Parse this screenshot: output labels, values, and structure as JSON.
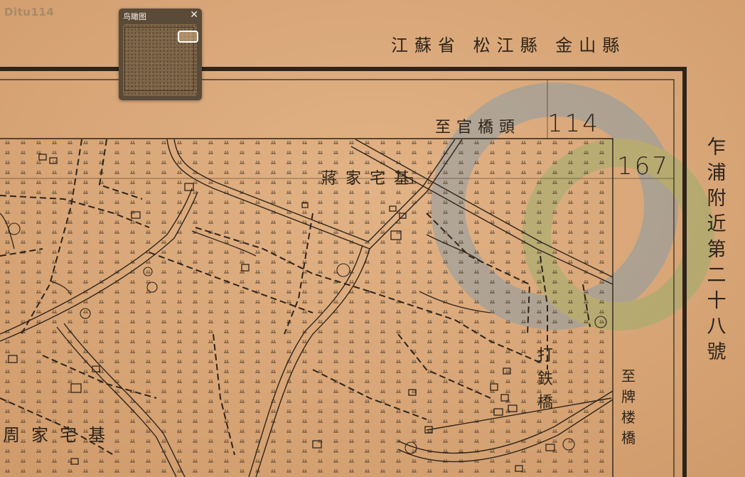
{
  "watermark": {
    "logo_text": "Ditu114"
  },
  "overview": {
    "title": "鸟瞰图",
    "close_glyph": "✕"
  },
  "sheet": {
    "province_county_title": "江蘇省 松江縣 金山縣",
    "sheet_number": "乍浦附近第二十八號"
  },
  "edge_labels": {
    "top": "至官橋頭",
    "right": "至牌楼橋"
  },
  "grid_numbers": {
    "top": "114",
    "right": "167"
  },
  "place_labels": {
    "jiang_jia_zhai": "蔣家宅基",
    "zhou_jia_zhai": "周家宅基",
    "da_tie_qiao": "打鉄橋"
  },
  "colors": {
    "paper": "#d9a877",
    "ink": "#2e241a",
    "overview_panel": "#5a4a38",
    "watermark_blue": "#7a9ab0",
    "watermark_green": "#8fb06a"
  }
}
